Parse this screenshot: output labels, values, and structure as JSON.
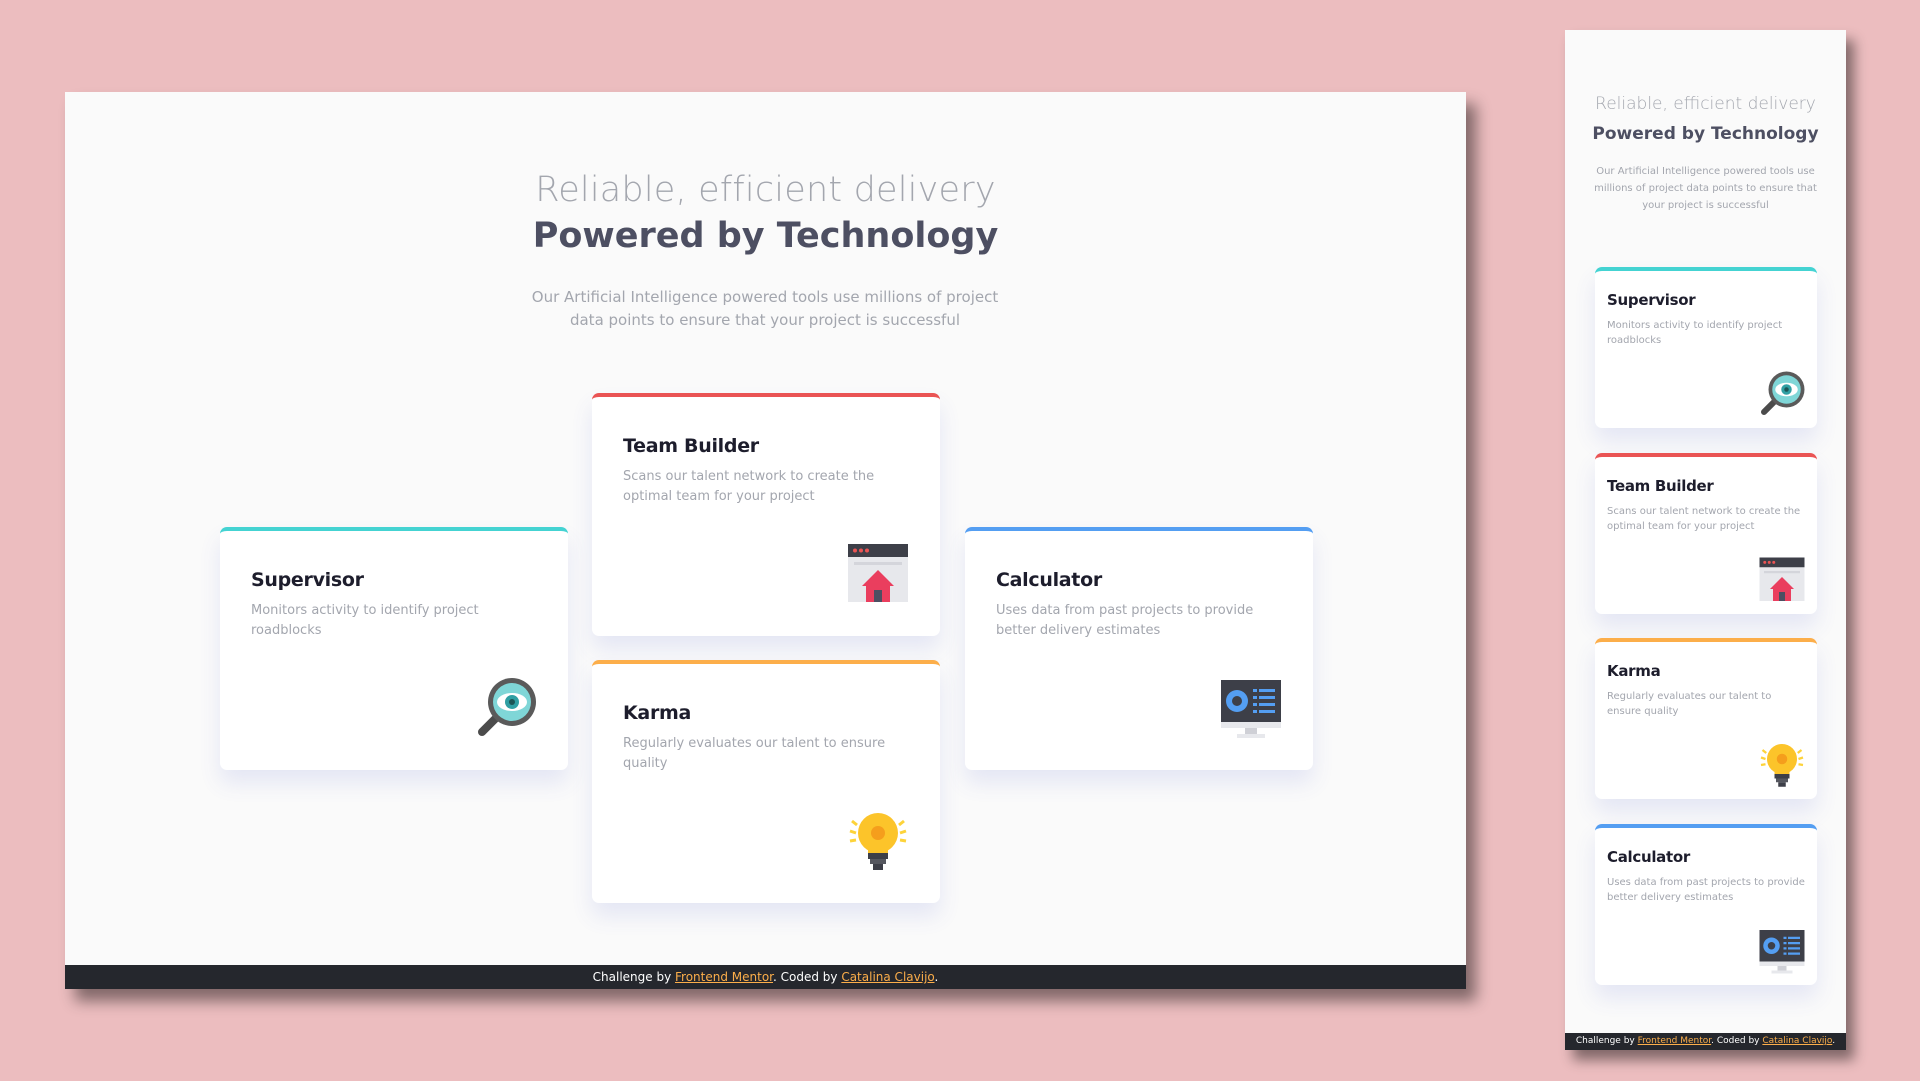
{
  "header": {
    "subtitle": "Reliable, efficient delivery",
    "title": "Powered by Technology",
    "description": "Our Artificial Intelligence powered tools use millions of project data points to ensure that your project is successful"
  },
  "cards": {
    "supervisor": {
      "title": "Supervisor",
      "text": "Monitors activity to identify project roadblocks",
      "icon": "supervisor-magnifier-icon",
      "accent": "#44d3d2"
    },
    "team_builder": {
      "title": "Team Builder",
      "text": "Scans our talent network to create the optimal team for your project",
      "icon": "team-builder-window-icon",
      "accent": "#ea5454"
    },
    "karma": {
      "title": "Karma",
      "text": "Regularly evaluates our talent to ensure quality",
      "icon": "karma-lightbulb-icon",
      "accent": "#fcae4a"
    },
    "calculator": {
      "title": "Calculator",
      "text": "Uses data from past projects to provide better delivery estimates",
      "icon": "calculator-monitor-icon",
      "accent": "#549ef2"
    }
  },
  "footer": {
    "prefix": "Challenge by",
    "link1": "Frontend Mentor",
    "middle": ". Coded by",
    "link2": "Catalina Clavijo",
    "suffix": "."
  },
  "colors": {
    "page_background": "#ecbdbf",
    "card_background": "#ffffff",
    "title_color": "#4d4f62",
    "muted_text": "#a3a6ae",
    "footer_background": "#25272d",
    "link_color": "#fcae4a"
  }
}
